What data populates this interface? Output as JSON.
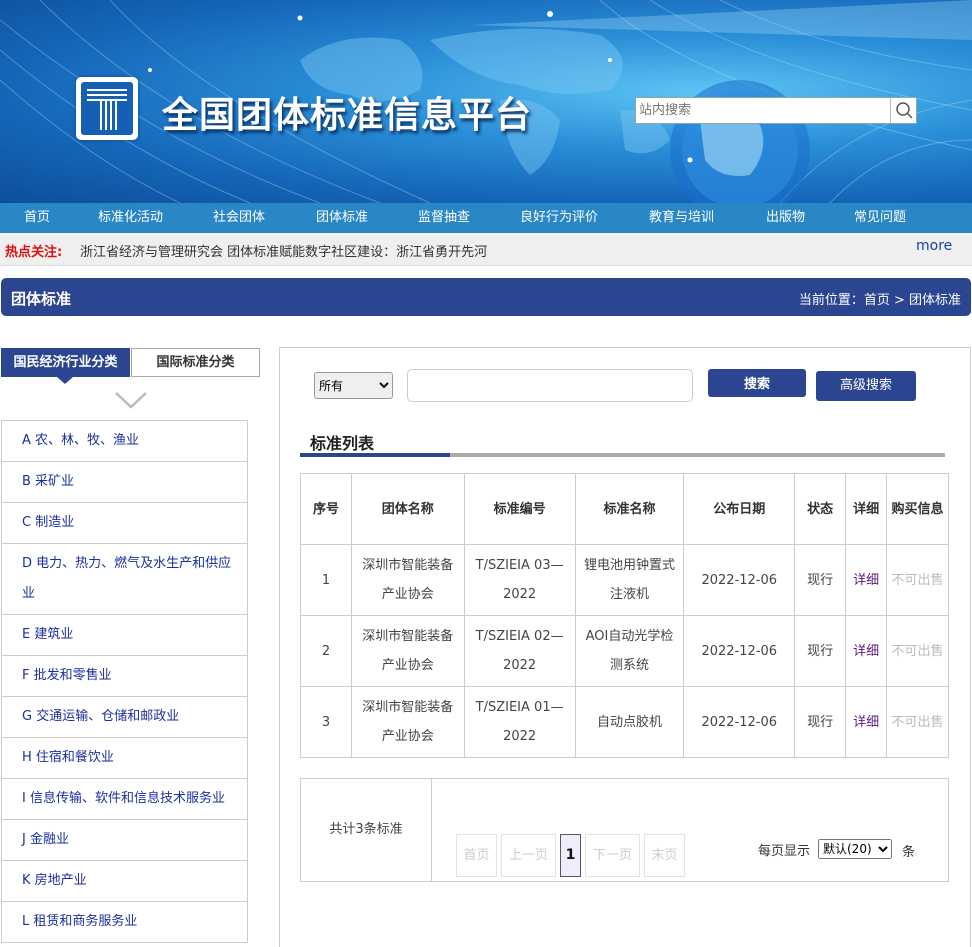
{
  "site": {
    "title": "全国团体标准信息平台",
    "search_placeholder": "站内搜索"
  },
  "nav": {
    "items": [
      "首页",
      "标准化活动",
      "社会团体",
      "团体标准",
      "监督抽查",
      "良好行为评价",
      "教育与培训",
      "出版物",
      "常见问题"
    ]
  },
  "hot": {
    "label": "热点关注:",
    "text": "浙江省经济与管理研究会 团体标准赋能数字社区建设：浙江省勇开先河",
    "more": "more"
  },
  "page": {
    "title": "团体标准",
    "breadcrumb": "当前位置：首页 > 团体标准"
  },
  "sidebar": {
    "tab_active": "国民经济行业分类",
    "tab_inactive": "国际标准分类",
    "categories": [
      "A 农、林、牧、渔业",
      "B 采矿业",
      "C 制造业",
      "D 电力、热力、燃气及水生产和供应业",
      "E 建筑业",
      "F 批发和零售业",
      "G 交通运输、仓储和邮政业",
      "H 住宿和餐饮业",
      "I 信息传输、软件和信息技术服务业",
      "J 金融业",
      "K 房地产业",
      "L 租赁和商务服务业"
    ]
  },
  "search": {
    "select_value": "所有",
    "keyword": "",
    "search_label": "搜索",
    "advanced_label": "高级搜索"
  },
  "list": {
    "title": "标准列表",
    "headers": [
      "序号",
      "团体名称",
      "标准编号",
      "标准名称",
      "公布日期",
      "状态",
      "详细",
      "购买信息"
    ],
    "rows": [
      [
        "1",
        "深圳市智能装备产业协会",
        "T/SZIEIA 03—2022",
        "锂电池用钟置式注液机",
        "2022-12-06",
        "现行",
        "详细",
        "不可出售"
      ],
      [
        "2",
        "深圳市智能装备产业协会",
        "T/SZIEIA 02—2022",
        "AOI自动光学检测系统",
        "2022-12-06",
        "现行",
        "详细",
        "不可出售"
      ],
      [
        "3",
        "深圳市智能装备产业协会",
        "T/SZIEIA 01—2022",
        "自动点胶机",
        "2022-12-06",
        "现行",
        "详细",
        "不可出售"
      ]
    ]
  },
  "pager": {
    "total": "共计3条标准",
    "first": "首页",
    "prev": "上一页",
    "current": "1",
    "next": "下一页",
    "last": "末页",
    "per_label": "每页显示",
    "per_value": "默认(20)",
    "per_unit": "条"
  },
  "colors": {
    "primary": "#2b4591",
    "nav": "#2a87c6",
    "hot": "#dd1111",
    "link": "#1a2fa0"
  }
}
